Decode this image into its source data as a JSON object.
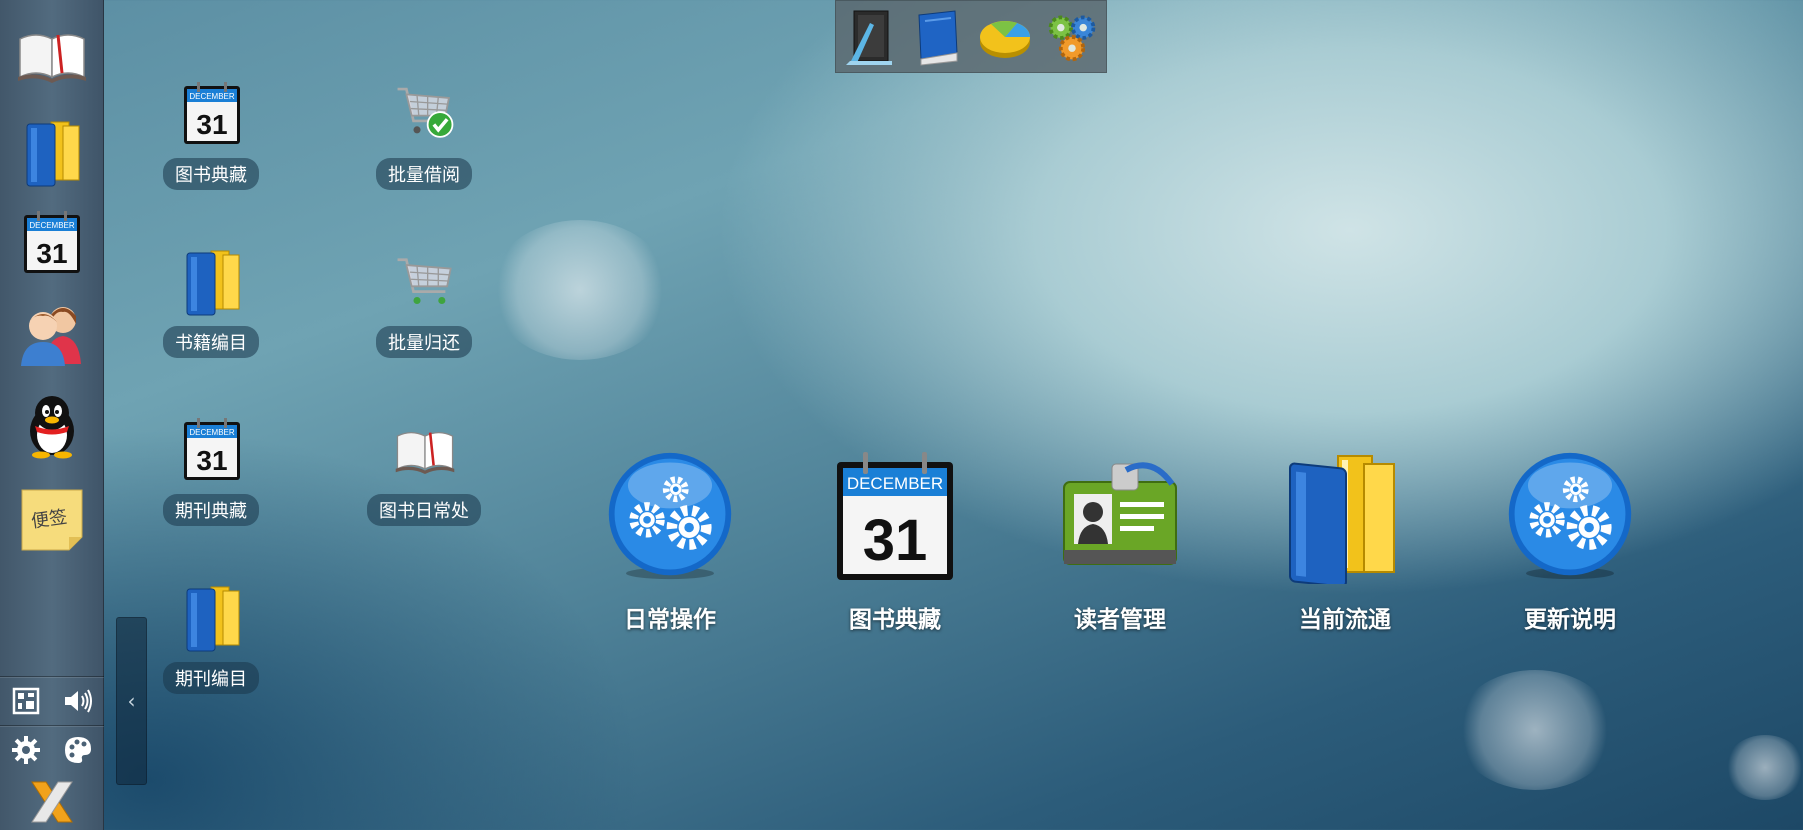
{
  "dock": {
    "apps": [
      {
        "name": "book-icon"
      },
      {
        "name": "books-icon"
      },
      {
        "name": "calendar-icon",
        "month": "DECEMBER",
        "day": "31"
      },
      {
        "name": "users-icon"
      },
      {
        "name": "qq-penguin-icon"
      },
      {
        "name": "sticky-note-icon",
        "text": "便签"
      }
    ],
    "tools": [
      "grid-icon",
      "speaker-icon",
      "gear-icon",
      "palette-icon",
      "close-icon"
    ]
  },
  "topbar": {
    "buttons": [
      "drafting-tools-icon",
      "blue-book-icon",
      "pie-chart-icon",
      "gears-icon"
    ]
  },
  "collapse": {
    "label": "‹"
  },
  "shortcuts": [
    {
      "label": "图书典藏",
      "icon": "calendar-icon",
      "month": "DECEMBER",
      "day": "31"
    },
    {
      "label": "批量借阅",
      "icon": "cart-check-icon"
    },
    {
      "label": "书籍编目",
      "icon": "books-icon"
    },
    {
      "label": "批量归还",
      "icon": "cart-icon"
    },
    {
      "label": "期刊典藏",
      "icon": "calendar-icon",
      "month": "DECEMBER",
      "day": "31"
    },
    {
      "label": "图书日常处",
      "icon": "book-icon"
    },
    {
      "label": "期刊编目",
      "icon": "books-icon"
    }
  ],
  "big_icons": [
    {
      "label": "日常操作",
      "icon": "gears-blue-icon"
    },
    {
      "label": "图书典藏",
      "icon": "calendar-icon",
      "month": "DECEMBER",
      "day": "31"
    },
    {
      "label": "读者管理",
      "icon": "id-card-icon"
    },
    {
      "label": "当前流通",
      "icon": "books-icon"
    },
    {
      "label": "更新说明",
      "icon": "gears-blue-icon"
    }
  ],
  "colors": {
    "accent": "#1e73c8",
    "dock": "#4a6175"
  }
}
